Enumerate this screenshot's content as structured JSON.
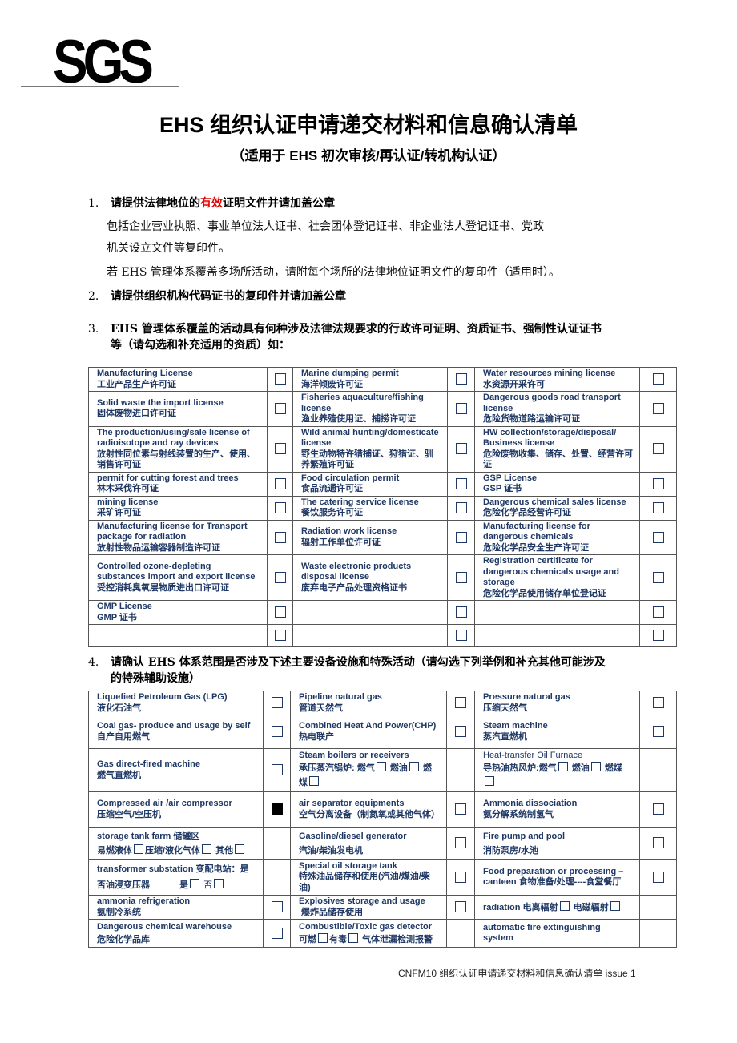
{
  "logo": {
    "text": "SGS"
  },
  "header": {
    "title": "EHS 组织认证申请递交材料和信息确认清单",
    "subtitle": "（适用于 EHS 初次审核/再认证/转机构认证）"
  },
  "sections": {
    "s1": {
      "number": "1.",
      "head_part1": "请提供法律地位的",
      "head_highlight": "有效",
      "head_part2": "证明文件并请加盖公章",
      "highlight_color": "#e00000",
      "para1_line1": "包括企业营业执照、事业单位法人证书、社会团体登记证书、非企业法人登记证书、党政",
      "para1_line2": "机关设立文件等复印件。",
      "para2": "若 EHS 管理体系覆盖多场所活动，请附每个场所的法律地位证明文件的复印件（适用时）。"
    },
    "s2": {
      "number": "2.",
      "head": "请提供组织机构代码证书的复印件并请加盖公章"
    },
    "s3": {
      "number": "3.",
      "head_line1": "EHS 管理体系覆盖的活动具有何种涉及法律法规要求的行政许可证明、资质证书、强制性认证证书",
      "head_line2": "等（请勾选和补充适用的资质）如："
    },
    "s4": {
      "number": "4.",
      "head_line1": "请确认 EHS 体系范围是否涉及下述主要设备设施和特殊活动（请勾选下列举例和补充其他可能涉及",
      "head_line2": "的特殊辅助设施）"
    }
  },
  "licenses_table": {
    "rows": [
      [
        {
          "en": "Manufacturing License",
          "cn": "工业产品生产许可证",
          "checked": false
        },
        {
          "en": "Marine dumping permit",
          "cn": "海洋倾废许可证",
          "checked": false
        },
        {
          "en": "Water resources mining license",
          "cn": "水资源开采许可",
          "checked": false
        }
      ],
      [
        {
          "en": "Solid waste the import license",
          "cn": "固体废物进口许可证",
          "checked": false
        },
        {
          "en": "Fisheries aquaculture/fishing license",
          "cn": "渔业养殖使用证、捕捞许可证",
          "checked": false
        },
        {
          "en": "Dangerous goods road transport license",
          "cn": "危险货物道路运输许可证",
          "checked": false
        }
      ],
      [
        {
          "en": "The production/using/sale license of radioisotope and ray devices",
          "cn": "放射性同位素与射线装置的生产、使用、销售许可证",
          "checked": false
        },
        {
          "en": "Wild animal hunting/domesticate license",
          "cn": "野生动物特许猎捕证、狩猎证、驯养繁殖许可证",
          "checked": false
        },
        {
          "en": "HW collection/storage/disposal/ Business license",
          "cn": "危险废物收集、储存、处置、经营许可证",
          "checked": false
        }
      ],
      [
        {
          "en": "permit for cutting forest and trees",
          "cn": "林木采伐许可证",
          "checked": false
        },
        {
          "en": "Food circulation permit",
          "cn": "食品流通许可证",
          "checked": false
        },
        {
          "en": "GSP License",
          "cn": "GSP 证书",
          "checked": false
        }
      ],
      [
        {
          "en": "mining license",
          "cn": "采矿许可证",
          "checked": false
        },
        {
          "en": "The catering service license",
          "cn": "餐饮服务许可证",
          "checked": false
        },
        {
          "en": "Dangerous chemical sales license",
          "cn": "危险化学品经营许可证",
          "checked": false
        }
      ],
      [
        {
          "en": "Manufacturing license for Transport package for radiation",
          "cn": "放射性物品运输容器制造许可证",
          "checked": false
        },
        {
          "en": "Radiation work license",
          "cn": "辐射工作单位许可证",
          "checked": false
        },
        {
          "en": "Manufacturing license for dangerous chemicals",
          "cn": "危险化学品安全生产许可证",
          "checked": false
        }
      ],
      [
        {
          "en": "Controlled ozone-depleting substances import and export license",
          "cn": "受控消耗臭氧层物质进出口许可证",
          "checked": false
        },
        {
          "en": "Waste electronic products disposal license",
          "cn": "废弃电子产品处理资格证书",
          "checked": false
        },
        {
          "en": "Registration certificate for dangerous chemicals usage and storage",
          "cn": "危险化学品使用储存单位登记证",
          "checked": false
        }
      ],
      [
        {
          "en": "GMP License",
          "cn": "GMP 证书",
          "checked": false
        },
        {
          "en": "",
          "cn": "",
          "checked": false
        },
        {
          "en": "",
          "cn": "",
          "checked": false
        }
      ],
      [
        {
          "en": "",
          "cn": "",
          "checked": false
        },
        {
          "en": "",
          "cn": "",
          "checked": false
        },
        {
          "en": "",
          "cn": "",
          "checked": false
        }
      ]
    ]
  },
  "facilities_table": {
    "r1": {
      "c1": {
        "en": "Liquefied Petroleum Gas (LPG)",
        "cn": "液化石油气",
        "checked": false
      },
      "c2": {
        "en": "Pipeline natural gas",
        "cn": "管道天然气",
        "checked": false
      },
      "c3": {
        "en": "Pressure natural gas",
        "cn": "压缩天然气",
        "checked": false
      }
    },
    "r2": {
      "c1": {
        "en": "Coal gas- produce and usage by self",
        "cn": "自产自用燃气",
        "checked": false
      },
      "c2": {
        "en": "Combined Heat And Power(CHP)",
        "cn": "热电联产",
        "checked": false
      },
      "c3": {
        "en": "Steam machine",
        "cn": "蒸汽直燃机",
        "checked": false
      }
    },
    "r3": {
      "c1": {
        "en": "Gas direct-fired machine",
        "cn": "燃气直燃机",
        "checked": false
      },
      "c2": {
        "en": "Steam boilers or receivers",
        "cn_a": "承压蒸汽锅炉: 燃气",
        "cn_b": "燃油",
        "cn_c": "燃煤"
      },
      "c3": {
        "en": "Heat-transfer Oil Furnace",
        "cn_a": "导热油热风炉:燃气",
        "cn_b": "燃油",
        "cn_c": "燃煤"
      }
    },
    "r4": {
      "c1": {
        "en": "Compressed air /air compressor",
        "cn": "压缩空气/空压机",
        "checked": true
      },
      "c2": {
        "en": "air separator equipments",
        "cn": "空气分离设备（制氮氧或其他气体）",
        "checked": false
      },
      "c3": {
        "en": "Ammonia dissociation",
        "cn": "氨分解系统制氢气",
        "checked": false
      }
    },
    "r5": {
      "c1": {
        "en": "storage tank farm 储罐区",
        "cn_a": "易燃液体",
        "cn_b": "压缩/液化气体",
        "cn_c": "其他"
      },
      "c2": {
        "en": "Gasoline/diesel generator",
        "cn": "汽油/柴油发电机",
        "checked": false
      },
      "c3": {
        "en": "Fire pump and pool",
        "cn": "消防泵房/水池",
        "checked": false
      }
    },
    "r6": {
      "c1": {
        "en": "transformer substation 变配电站：是否油浸变压器",
        "yes": "是",
        "no": "否"
      },
      "c2": {
        "en": "Special oil storage tank",
        "cn": "特殊油品储存和使用(汽油/煤油/柴油)",
        "checked": false
      },
      "c3": {
        "en": "Food preparation or processing – canteen  食物准备/处理----食堂餐厅",
        "checked": false
      }
    },
    "r7": {
      "c1": {
        "en": "ammonia refrigeration",
        "cn": "氨制冷系统",
        "checked": false
      },
      "c2": {
        "en": "Explosives storage and usage",
        "cn": "爆炸品储存使用",
        "checked": false
      },
      "c3": {
        "en": "radiation 电离辐射",
        "cn_b": "电磁辐射"
      }
    },
    "r8": {
      "c1": {
        "en": "Dangerous chemical warehouse",
        "cn": "危险化学品库",
        "checked": false
      },
      "c2": {
        "en": "Combustible/Toxic gas detector",
        "cn_a": "可燃",
        "cn_b": "有毒",
        "cn_c": "气体泄漏检测报警"
      },
      "c3": {
        "en": "automatic fire extinguishing system"
      }
    }
  },
  "footer": {
    "text": "CNFM10  组织认证申请递交材料和信息确认清单  issue 1"
  }
}
